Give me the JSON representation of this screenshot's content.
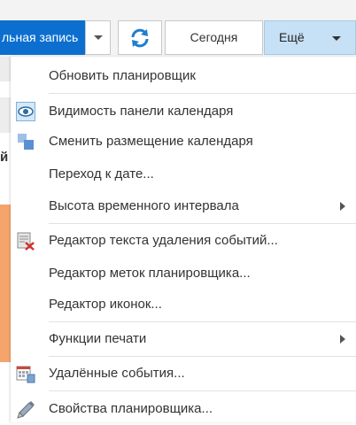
{
  "toolbar": {
    "split_label": "льная запись",
    "today_label": "Сегодня",
    "more_label": "Ещё"
  },
  "background": {
    "letter": "й"
  },
  "menu": {
    "items": [
      {
        "label": "Обновить планировщик"
      },
      {
        "label": "Видимость панели календаря",
        "icon": "eye-icon"
      },
      {
        "label": "Сменить размещение календаря",
        "icon": "layout-icon"
      },
      {
        "label": "Переход к дате..."
      },
      {
        "label": "Высота временного интервала",
        "submenu": true
      },
      {
        "label": "Редактор текста удаления событий...",
        "icon": "delete-text-editor-icon"
      },
      {
        "label": "Редактор меток планировщика..."
      },
      {
        "label": "Редактор иконок..."
      },
      {
        "label": "Функции печати",
        "submenu": true
      },
      {
        "label": "Удалённые события...",
        "icon": "deleted-events-icon"
      },
      {
        "label": "Свойства планировщика...",
        "icon": "pencil-icon"
      }
    ]
  },
  "colors": {
    "accent": "#0c6fd0",
    "more_button_bg": "#c6e0f5",
    "calendar_event": "#f4a56c"
  }
}
